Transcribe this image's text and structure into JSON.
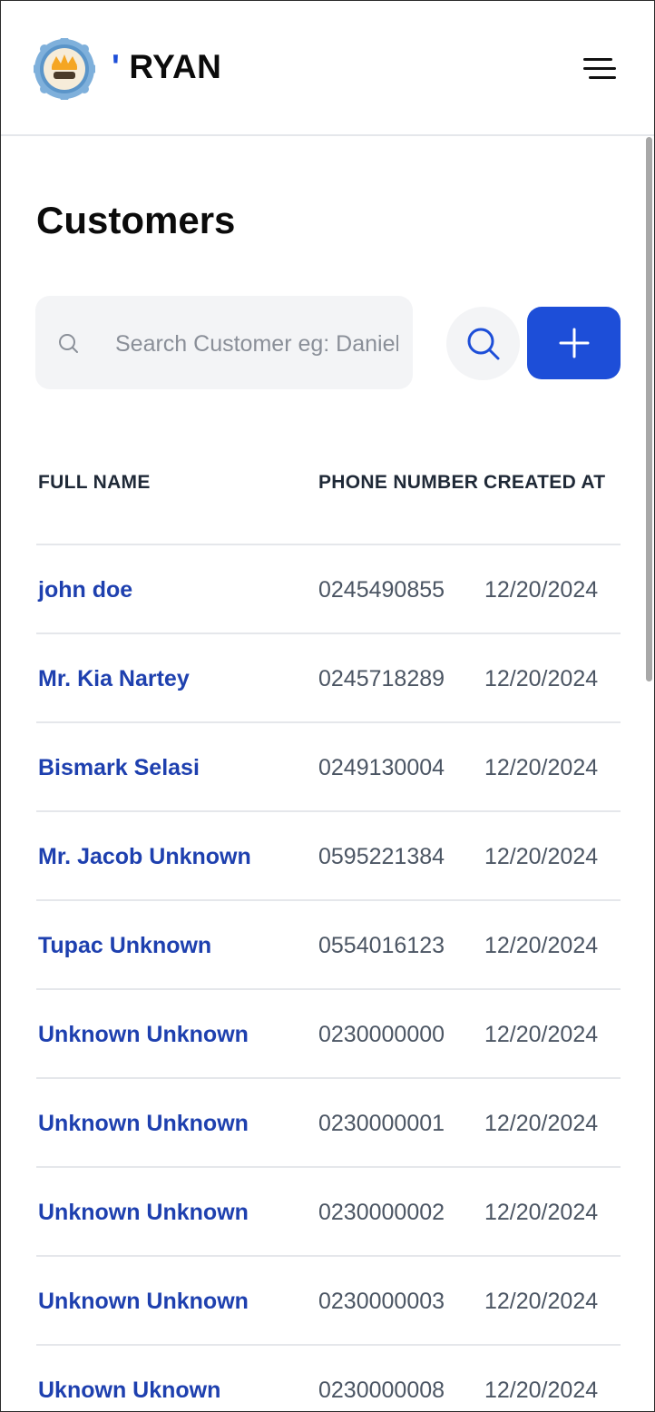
{
  "header": {
    "brand_tick": "'",
    "brand_name": "RYAN"
  },
  "page": {
    "title": "Customers"
  },
  "search": {
    "placeholder": "Search Customer eg: Daniel"
  },
  "table": {
    "columns": [
      "FULL NAME",
      "PHONE NUMBER",
      "CREATED AT"
    ],
    "rows": [
      {
        "name": "john doe",
        "phone": "0245490855",
        "created": "12/20/2024"
      },
      {
        "name": "Mr. Kia Nartey",
        "phone": "0245718289",
        "created": "12/20/2024"
      },
      {
        "name": "Bismark Selasi",
        "phone": "0249130004",
        "created": "12/20/2024"
      },
      {
        "name": "Mr. Jacob Unknown",
        "phone": "0595221384",
        "created": "12/20/2024"
      },
      {
        "name": "Tupac Unknown",
        "phone": "0554016123",
        "created": "12/20/2024"
      },
      {
        "name": "Unknown Unknown",
        "phone": "0230000000",
        "created": "12/20/2024"
      },
      {
        "name": "Unknown Unknown",
        "phone": "0230000001",
        "created": "12/20/2024"
      },
      {
        "name": "Unknown Unknown",
        "phone": "0230000002",
        "created": "12/20/2024"
      },
      {
        "name": "Unknown Unknown",
        "phone": "0230000003",
        "created": "12/20/2024"
      },
      {
        "name": "Uknown Uknown",
        "phone": "0230000008",
        "created": "12/20/2024"
      }
    ]
  },
  "colors": {
    "accent": "#1d4ed8",
    "link": "#1e40af",
    "muted_text": "#4b5563",
    "input_bg": "#f3f4f6"
  },
  "icons": {
    "logo": "crown-badge-logo",
    "menu": "hamburger-menu-icon",
    "search_inline": "search-icon",
    "search_button": "search-icon",
    "add": "plus-icon"
  }
}
